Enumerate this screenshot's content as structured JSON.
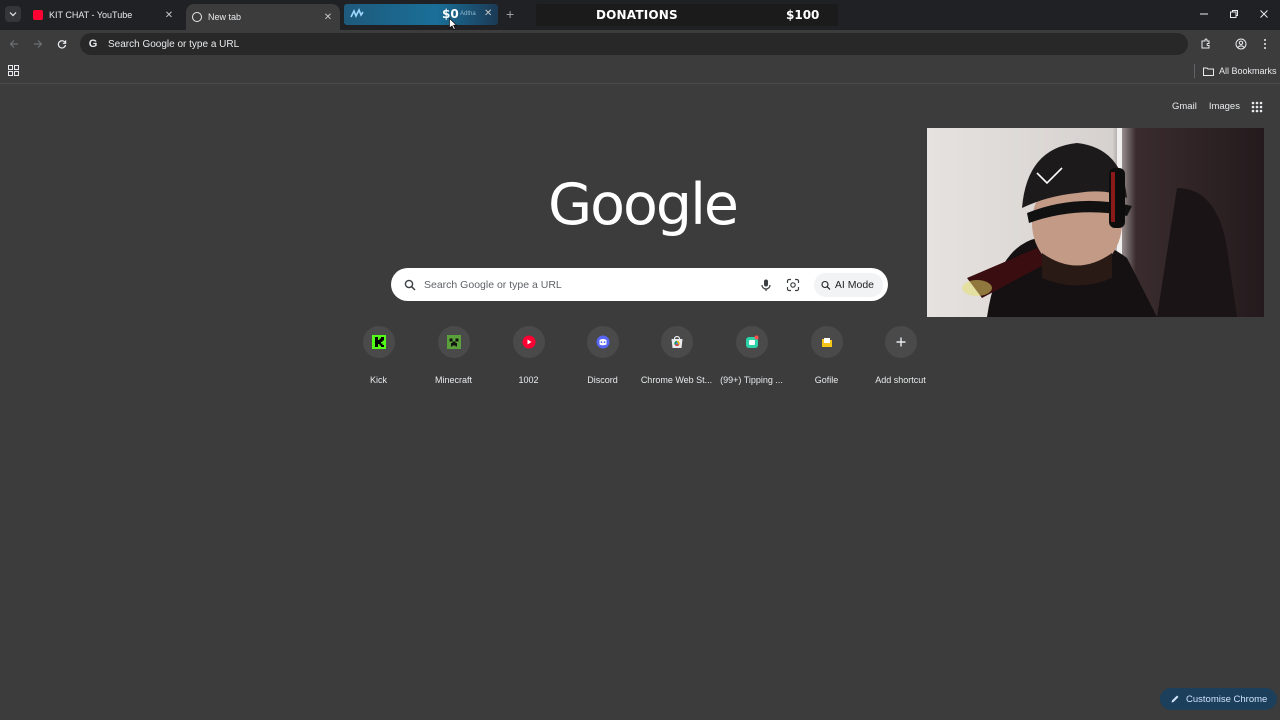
{
  "tabs": [
    {
      "title": "KIT CHAT - YouTube",
      "favicon": "youtube-icon"
    },
    {
      "title": "New tab",
      "favicon": "chrome-icon"
    }
  ],
  "overlay": {
    "amount": "$0",
    "small_text": "Adtha"
  },
  "donations": {
    "label": "DONATIONS",
    "goal": "$100"
  },
  "toolbar": {
    "omnibox_text": "Search Google or type a URL"
  },
  "bookmarks": {
    "all_bookmarks": "All Bookmarks"
  },
  "top_links": {
    "gmail": "Gmail",
    "images": "Images"
  },
  "search": {
    "placeholder": "Search Google or type a URL",
    "ai_mode": "AI Mode"
  },
  "logo": "Google",
  "shortcuts": [
    {
      "label": "Kick",
      "icon": "kick-icon",
      "color": "#53fc18"
    },
    {
      "label": "Minecraft",
      "icon": "minecraft-icon",
      "color": "#5aa13c"
    },
    {
      "label": "1002",
      "icon": "youtube-icon",
      "color": "#ff0033"
    },
    {
      "label": "Discord",
      "icon": "discord-icon",
      "color": "#5865f2"
    },
    {
      "label": "Chrome Web St...",
      "icon": "chrome-web-store-icon",
      "color": "#e8eaed"
    },
    {
      "label": "(99+) Tipping ...",
      "icon": "tipping-icon",
      "color": "#2ad3a8"
    },
    {
      "label": "Gofile",
      "icon": "gofile-icon",
      "color": "#f5c518"
    },
    {
      "label": "Add shortcut",
      "icon": "plus-icon",
      "color": "#e8eaed"
    }
  ],
  "customise": "Customise Chrome",
  "colors": {
    "page_bg": "#3c3c3c",
    "tab_strip": "#202124",
    "accent": "#1c3f5c"
  }
}
